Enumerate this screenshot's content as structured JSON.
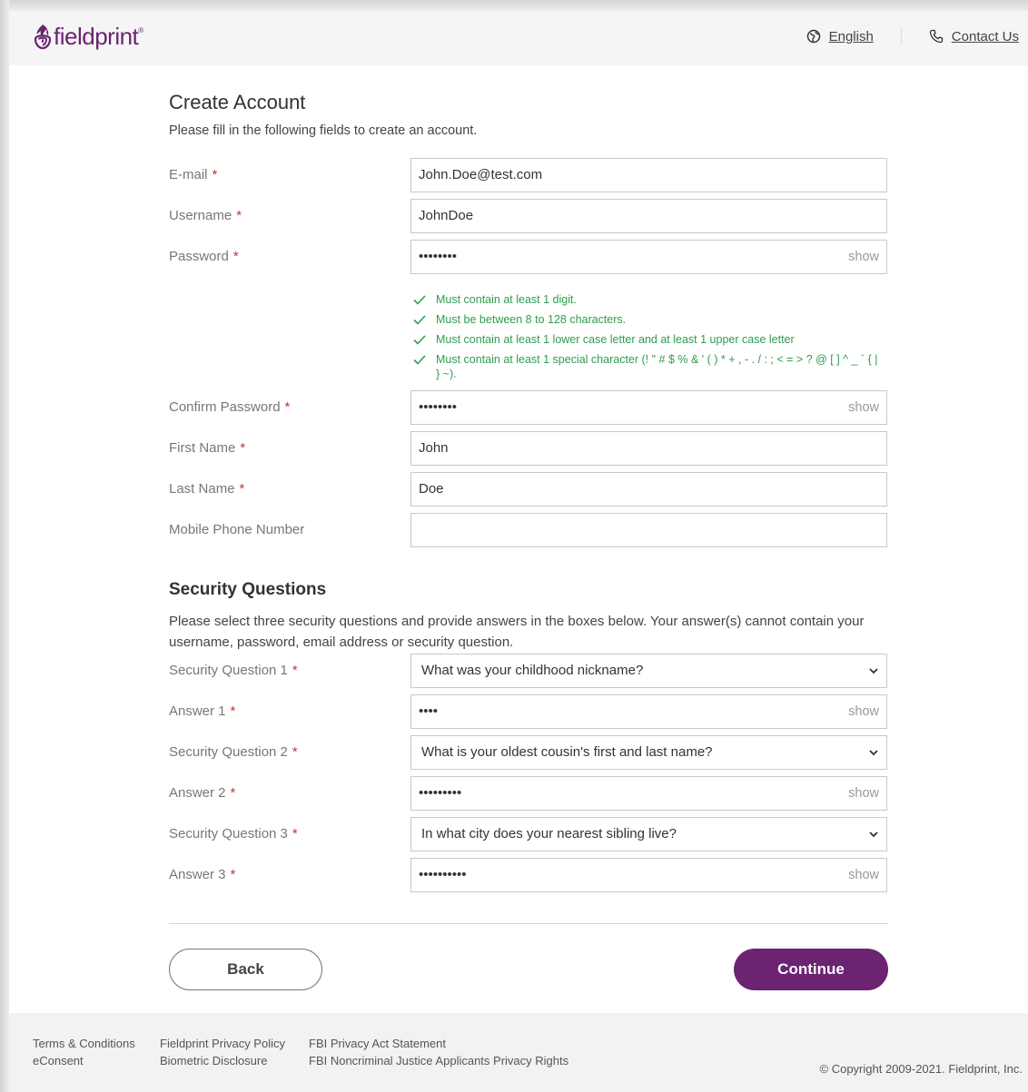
{
  "header": {
    "logo_text": "fieldprint",
    "logo_tm": "®",
    "language_link": "English",
    "contact_link": "Contact Us"
  },
  "form": {
    "title": "Create Account",
    "intro": "Please fill in the following fields to create an account.",
    "required_mark": "*",
    "email": {
      "label": "E-mail",
      "value": "John.Doe@test.com"
    },
    "username": {
      "label": "Username",
      "value": "JohnDoe"
    },
    "password": {
      "label": "Password",
      "value": "••••••••",
      "show_label": "show"
    },
    "password_rules": [
      "Must contain at least 1 digit.",
      "Must be between 8 to 128 characters.",
      "Must contain at least 1 lower case letter and at least 1 upper case letter",
      "Must contain at least 1 special character (! \" # $ % & ' ( ) * + , - . / : ; < = > ? @ [ ] ^ _ ` { | } ~)."
    ],
    "confirm_password": {
      "label": "Confirm Password",
      "value": "••••••••",
      "show_label": "show"
    },
    "first_name": {
      "label": "First Name",
      "value": "John"
    },
    "last_name": {
      "label": "Last Name",
      "value": "Doe"
    },
    "mobile": {
      "label": "Mobile Phone Number",
      "value": ""
    }
  },
  "security": {
    "title": "Security Questions",
    "intro": "Please select three security questions and provide answers in the boxes below. Your answer(s) cannot contain your username, password, email address or security question.",
    "q1": {
      "label": "Security Question 1",
      "value": "What was your childhood nickname?"
    },
    "a1": {
      "label": "Answer 1",
      "value": "••••",
      "show_label": "show"
    },
    "q2": {
      "label": "Security Question 2",
      "value": "What is your oldest cousin's first and last name?"
    },
    "a2": {
      "label": "Answer 2",
      "value": "•••••••••",
      "show_label": "show"
    },
    "q3": {
      "label": "Security Question 3",
      "value": "In what city does your nearest sibling live?"
    },
    "a3": {
      "label": "Answer 3",
      "value": "••••••••••",
      "show_label": "show"
    }
  },
  "buttons": {
    "back": "Back",
    "continue": "Continue"
  },
  "footer": {
    "col1": [
      "Terms & Conditions",
      "eConsent"
    ],
    "col2": [
      "Fieldprint Privacy Policy",
      "Biometric Disclosure"
    ],
    "col3": [
      "FBI Privacy Act Statement",
      "FBI Noncriminal Justice Applicants Privacy Rights"
    ],
    "copyright": "© Copyright 2009-2021. Fieldprint, Inc."
  },
  "colors": {
    "brand": "#6b2372",
    "success": "#2e9d4f",
    "required": "#c0392b"
  }
}
